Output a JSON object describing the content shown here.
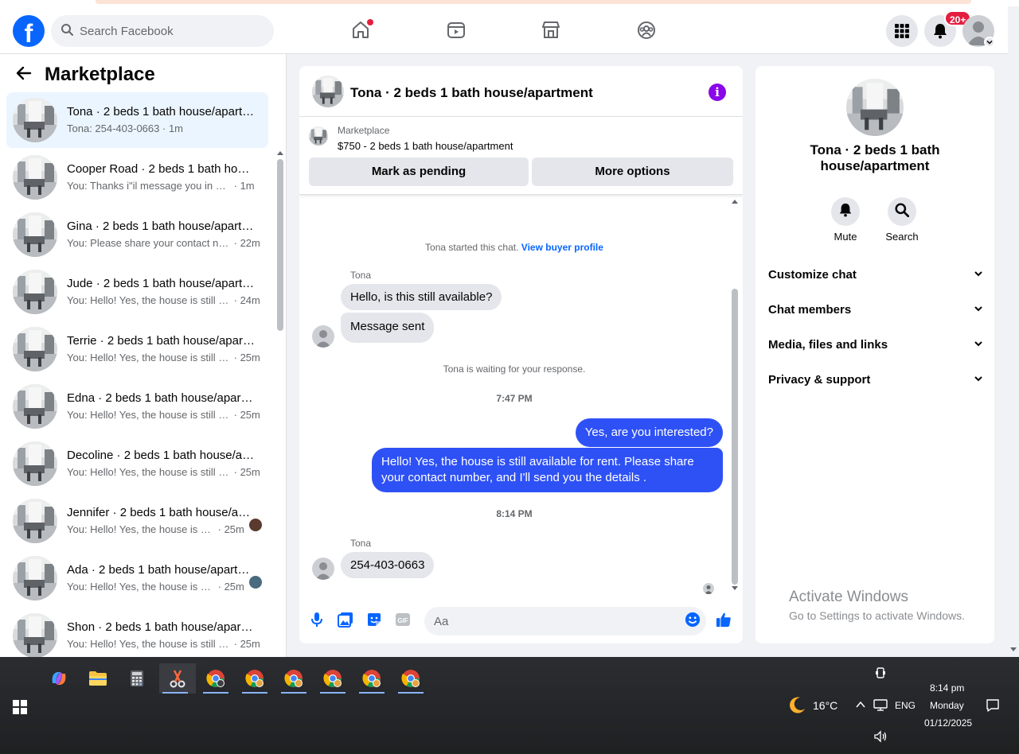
{
  "header": {
    "search_placeholder": "Search Facebook",
    "notification_badge": "20+",
    "logo_letter": "f"
  },
  "left": {
    "title": "Marketplace",
    "conversations": [
      {
        "name": "Tona · 2 beds 1 bath house/apartment",
        "snippet": "Tona: 254-403-0663",
        "time": "· 1m",
        "active": true
      },
      {
        "name": "Cooper Road · 2 beds 1 bath house/apartment",
        "snippet": "You: Thanks i\"il message you in a ...",
        "time": "· 1m"
      },
      {
        "name": "Gina · 2 beds 1 bath house/apartment",
        "snippet": "You: Please share your contact nu...",
        "time": "· 22m"
      },
      {
        "name": "Jude · 2 beds 1 bath house/apartment",
        "snippet": "You: Hello! Yes, the house is still a...",
        "time": "· 24m"
      },
      {
        "name": "Terrie · 2 beds 1 bath house/apartment",
        "snippet": "You: Hello! Yes, the house is still a...",
        "time": "· 25m"
      },
      {
        "name": "Edna · 2 beds 1 bath house/apartment",
        "snippet": "You: Hello! Yes, the house is still a...",
        "time": "· 25m"
      },
      {
        "name": "Decoline · 2 beds 1 bath house/apartment",
        "snippet": "You: Hello! Yes, the house is still a...",
        "time": "· 25m"
      },
      {
        "name": "Jennifer · 2 beds 1 bath house/apartment",
        "snippet": "You: Hello! Yes, the house is sti...",
        "time": "· 25m"
      },
      {
        "name": "Ada · 2 beds 1 bath house/apartment",
        "snippet": "You: Hello! Yes, the house is sti...",
        "time": "· 25m"
      },
      {
        "name": "Shon · 2 beds 1 bath house/apartment",
        "snippet": "You: Hello! Yes, the house is still a...",
        "time": "· 25m"
      }
    ]
  },
  "chat": {
    "title": "Tona · 2 beds 1 bath house/apartment",
    "listing_source": "Marketplace",
    "listing_price": "$750 - 2 beds 1 bath house/apartment",
    "mark_pending": "Mark as pending",
    "more_options": "More options",
    "started_text": "Tona started this chat.",
    "view_profile": "View buyer profile",
    "sender_name": "Tona",
    "msg_in_1": "Hello, is this still available?",
    "msg_in_2": "Message sent",
    "waiting": "Tona is waiting for your response.",
    "time_1": "7:47 PM",
    "msg_out_1": "Yes, are you interested?",
    "msg_out_2": "Hello! Yes, the house is still available for rent. Please share your contact number, and I'll send you the details .",
    "time_2": "8:14 PM",
    "msg_in_3": "254-403-0663",
    "composer_placeholder": "Aa"
  },
  "right": {
    "title": "Tona · 2 beds 1 bath house/apartment",
    "mute": "Mute",
    "search": "Search",
    "sections": [
      "Customize chat",
      "Chat members",
      "Media, files and links",
      "Privacy & support"
    ]
  },
  "watermark": {
    "line1": "Activate Windows",
    "line2": "Go to Settings to activate Windows."
  },
  "taskbar": {
    "temperature": "16°C",
    "language": "ENG",
    "time": "8:14 pm",
    "day": "Monday",
    "date": "01/12/2025"
  }
}
